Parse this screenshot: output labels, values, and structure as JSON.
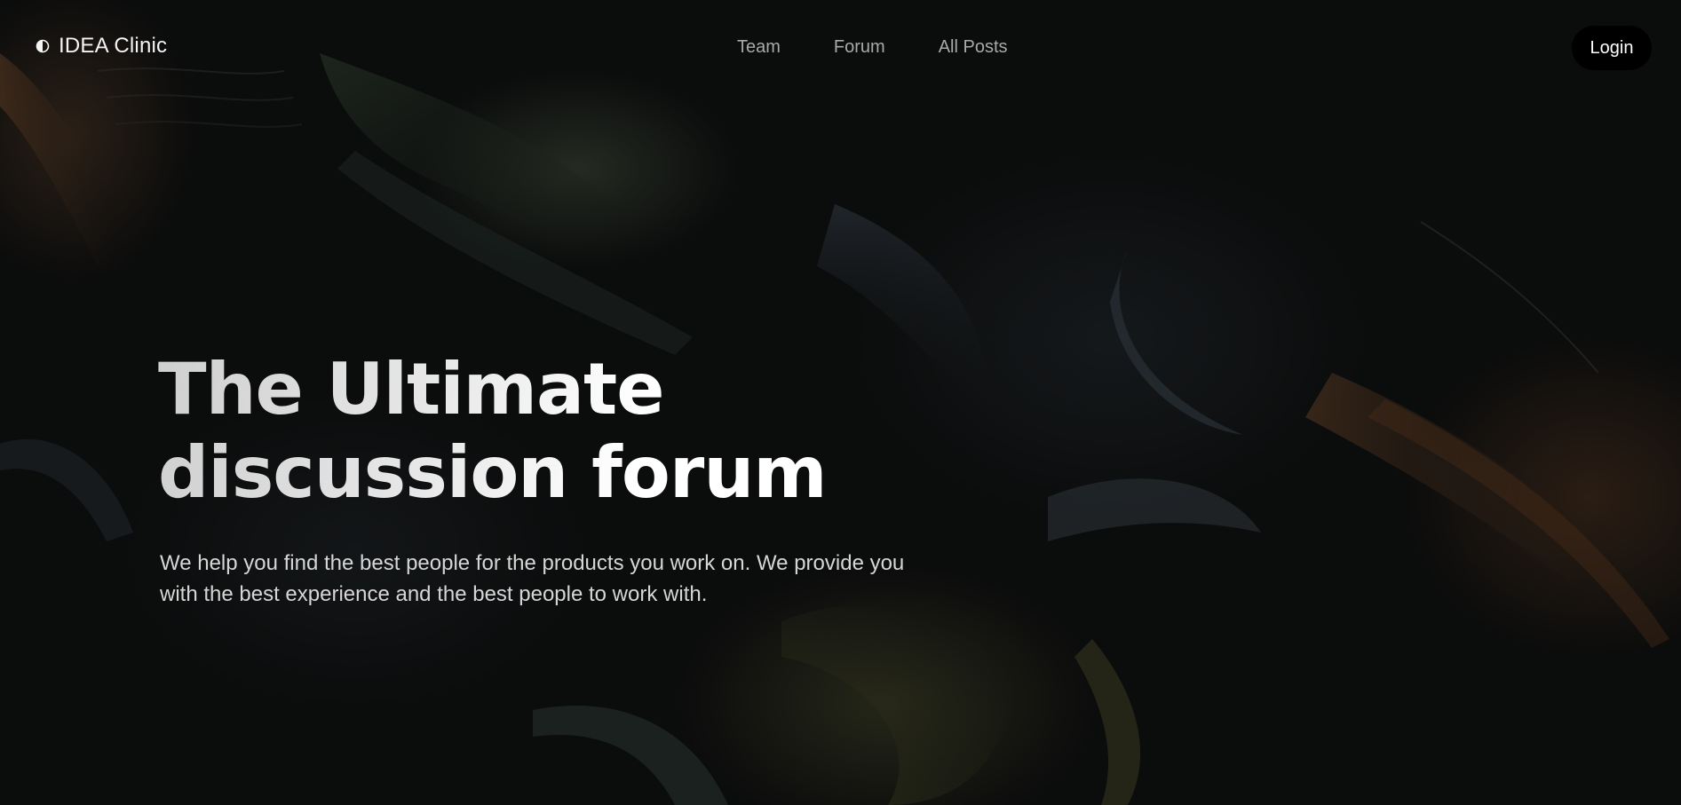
{
  "brand": {
    "name": "IDEA Clinic",
    "icon": "half-circle-icon"
  },
  "nav": {
    "links": [
      {
        "label": "Team"
      },
      {
        "label": "Forum"
      },
      {
        "label": "All Posts"
      }
    ],
    "login_label": "Login"
  },
  "hero": {
    "title_line1": "The Ultimate",
    "title_line2": "discussion forum",
    "subtitle": "We help you find the best people for the products you work on. We provide you with the best experience and the best people to work with."
  },
  "colors": {
    "background": "#0b0c0c",
    "text": "#ffffff",
    "nav_link": "#a9a9a9",
    "button_bg": "#000000"
  }
}
